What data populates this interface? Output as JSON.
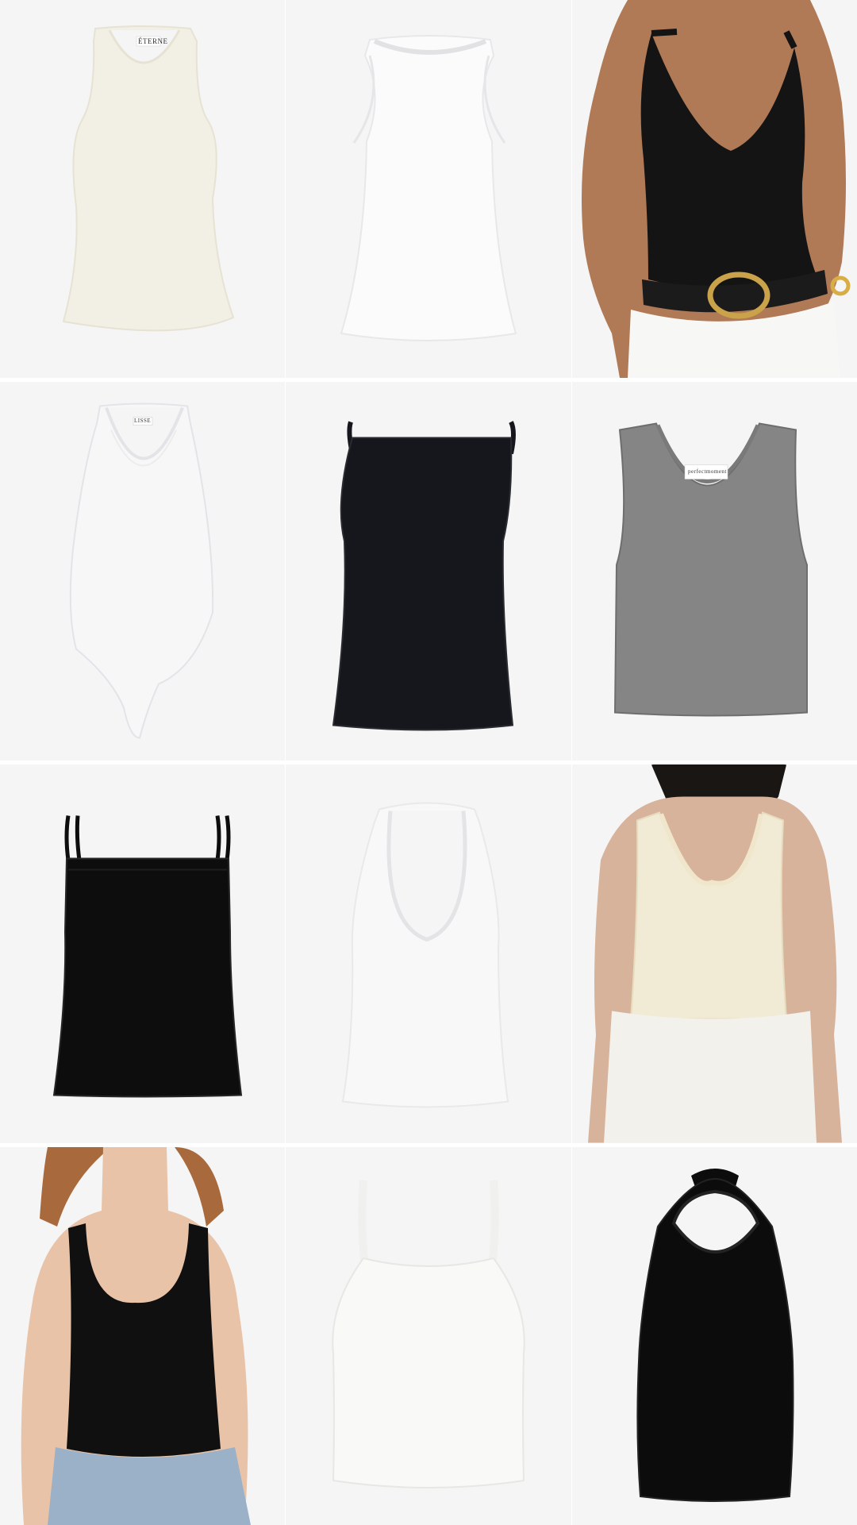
{
  "tiles": [
    {
      "id": "cream-tank",
      "colors": {
        "fill": "#f2efe4",
        "shade": "#e6e2d4"
      },
      "label": "ÉTERNE"
    },
    {
      "id": "white-racer-tank",
      "colors": {
        "fill": "#fbfbfb",
        "shade": "#e8e8ea"
      }
    },
    {
      "id": "model-black-halter-bodysuit",
      "colors": {
        "fill": "#141414",
        "skin": "#b07a57",
        "belt": "#1b1b1b",
        "buckle": "#c9a24a",
        "pants": "#f7f7f5"
      }
    },
    {
      "id": "white-racerback-bodysuit",
      "colors": {
        "fill": "#f7f7f8",
        "shade": "#e4e4e8"
      },
      "label": "LISSE"
    },
    {
      "id": "black-square-neck-cami",
      "colors": {
        "fill": "#16171c",
        "shade": "#2a2b31"
      }
    },
    {
      "id": "grey-scoop-tank",
      "colors": {
        "fill": "#858585",
        "shade": "#6e6e6e"
      },
      "label": "perfectmoment"
    },
    {
      "id": "black-double-strap-cami",
      "colors": {
        "fill": "#0d0d0d",
        "shade": "#262626"
      }
    },
    {
      "id": "white-halter-top",
      "colors": {
        "fill": "#f8f8f8",
        "shade": "#e9e9ea"
      }
    },
    {
      "id": "model-cream-scoop-tank",
      "colors": {
        "fill": "#f1ead5",
        "skin": "#d8b39b",
        "hair": "#1a1614",
        "pants": "#f3f1ec"
      }
    },
    {
      "id": "model-black-scoop-tank-jeans",
      "colors": {
        "fill": "#101010",
        "skin": "#e8c3a8",
        "hair": "#a86a3c",
        "jeans": "#9bb1c8"
      }
    },
    {
      "id": "white-cropped-cami",
      "colors": {
        "fill": "#f9f9f8",
        "shade": "#e8e7e4"
      }
    },
    {
      "id": "black-tie-halter",
      "colors": {
        "fill": "#0c0c0c",
        "shade": "#232323"
      }
    }
  ]
}
